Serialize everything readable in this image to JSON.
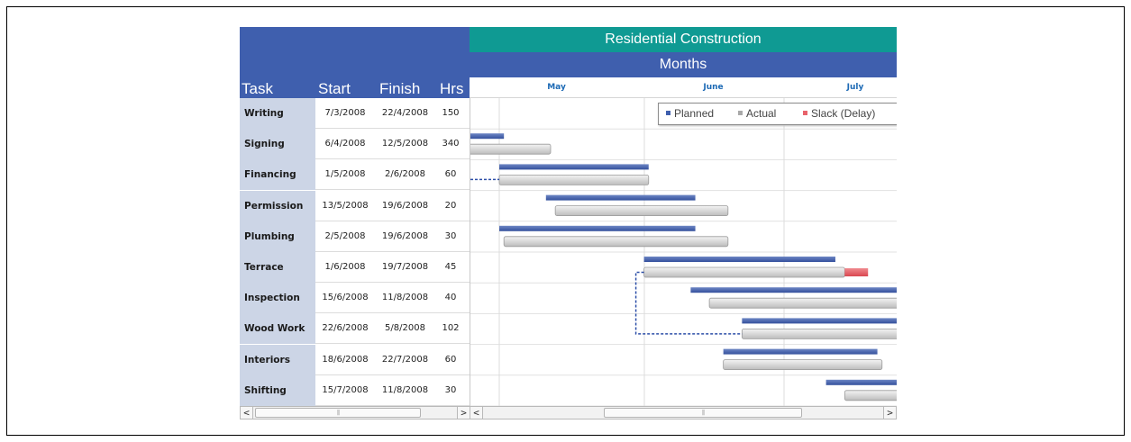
{
  "chart_data": {
    "type": "gantt",
    "title": "Residential Construction",
    "timeline_label": "Months",
    "months": [
      "May",
      "June",
      "July"
    ],
    "columns": [
      "Task",
      "Start",
      "Finish",
      "Hrs"
    ],
    "legend": [
      {
        "name": "Planned",
        "color": "#3f5fae"
      },
      {
        "name": "Actual",
        "color": "#c8c8c8"
      },
      {
        "name": "Slack (Delay)",
        "color": "#e8636b"
      }
    ],
    "tasks": [
      {
        "name": "Writing",
        "start": "7/3/2008",
        "finish": "22/4/2008",
        "hrs": "150",
        "planned": [
          "2008-03-07",
          "2008-04-22"
        ],
        "actual": [
          "2008-03-07",
          "2008-04-22"
        ]
      },
      {
        "name": "Signing",
        "start": "6/4/2008",
        "finish": "12/5/2008",
        "hrs": "340",
        "planned": [
          "2008-04-06",
          "2008-05-02"
        ],
        "actual": [
          "2008-04-06",
          "2008-05-12"
        ]
      },
      {
        "name": "Financing",
        "start": "1/5/2008",
        "finish": "2/6/2008",
        "hrs": "60",
        "planned": [
          "2008-05-01",
          "2008-06-02"
        ],
        "actual": [
          "2008-05-01",
          "2008-06-02"
        ]
      },
      {
        "name": "Permission",
        "start": "13/5/2008",
        "finish": "19/6/2008",
        "hrs": "20",
        "planned": [
          "2008-05-11",
          "2008-06-12"
        ],
        "actual": [
          "2008-05-13",
          "2008-06-19"
        ]
      },
      {
        "name": "Plumbing",
        "start": "2/5/2008",
        "finish": "19/6/2008",
        "hrs": "30",
        "planned": [
          "2008-05-01",
          "2008-06-12"
        ],
        "actual": [
          "2008-05-02",
          "2008-06-19"
        ]
      },
      {
        "name": "Terrace",
        "start": "1/6/2008",
        "finish": "19/7/2008",
        "hrs": "45",
        "planned": [
          "2008-06-01",
          "2008-07-12"
        ],
        "actual": [
          "2008-06-01",
          "2008-07-14"
        ],
        "slack": [
          "2008-07-14",
          "2008-07-19"
        ]
      },
      {
        "name": "Inspection",
        "start": "15/6/2008",
        "finish": "11/8/2008",
        "hrs": "40",
        "planned": [
          "2008-06-11",
          "2008-08-11"
        ],
        "actual": [
          "2008-06-15",
          "2008-08-11"
        ]
      },
      {
        "name": "Wood Work",
        "start": "22/6/2008",
        "finish": "5/8/2008",
        "hrs": "102",
        "planned": [
          "2008-06-22",
          "2008-08-05"
        ],
        "actual": [
          "2008-06-22",
          "2008-08-05"
        ]
      },
      {
        "name": "Interiors",
        "start": "18/6/2008",
        "finish": "22/7/2008",
        "hrs": "60",
        "planned": [
          "2008-06-18",
          "2008-07-21"
        ],
        "actual": [
          "2008-06-18",
          "2008-07-22"
        ]
      },
      {
        "name": "Shifting",
        "start": "15/7/2008",
        "finish": "11/8/2008",
        "hrs": "30",
        "planned": [
          "2008-07-10",
          "2008-08-11"
        ],
        "actual": [
          "2008-07-14",
          "2008-08-11"
        ]
      }
    ],
    "dependencies": [
      {
        "from": "Signing",
        "to": "Financing"
      },
      {
        "from": "Terrace",
        "to": "Wood Work"
      }
    ],
    "colors": {
      "header_blue": "#3f5fae",
      "title_teal": "#0f9a93",
      "task_cell": "#ccd5e6",
      "month_text": "#1d6ab5",
      "dependency": "#2c4fa8"
    }
  }
}
